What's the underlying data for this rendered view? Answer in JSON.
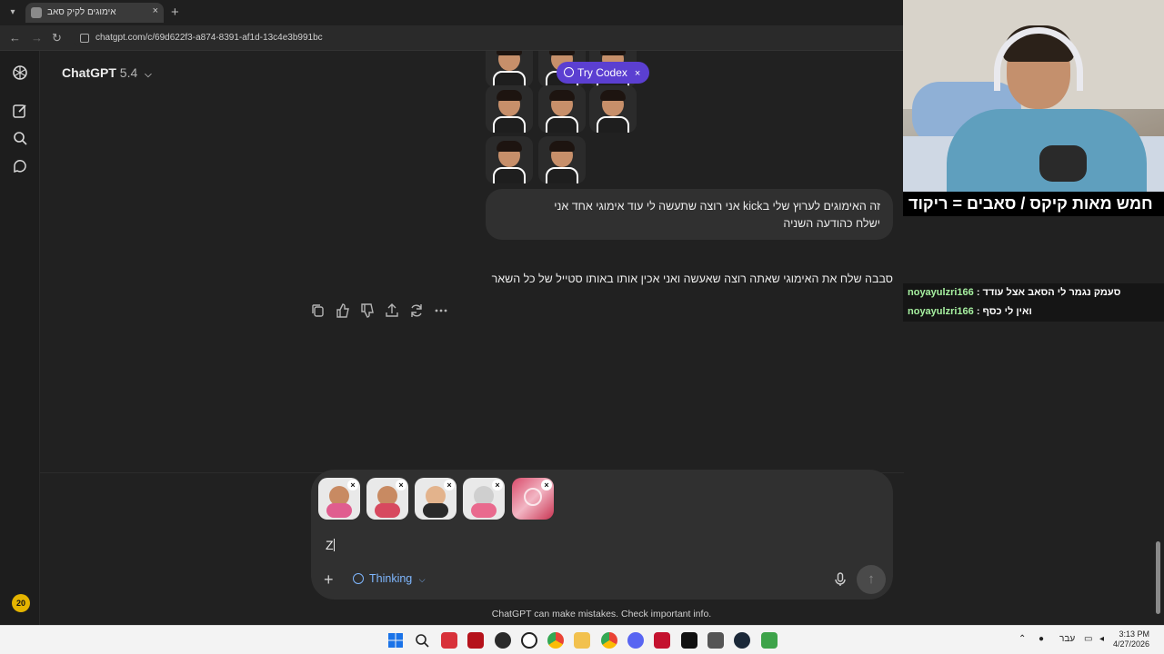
{
  "browser": {
    "tab_title": "אימוגים לקיק סאב",
    "tab_close": "×",
    "new_tab": "+",
    "url": "chatgpt.com/c/69d622f3-a874-8391-af1d-13c4e3b991bc"
  },
  "header": {
    "app_name": "ChatGPT",
    "model_version": "5.4"
  },
  "promo": {
    "label": "Try Codex",
    "close": "×"
  },
  "conversation": {
    "user_message_line1": "זה האימוגים לערוץ שלי בkick  אני רוצה שתעשה לי עוד אימוגי אחד אני",
    "user_message_line2": "ישלח כהודעה השניה",
    "assistant_reply": "סבבה שלח את האימוגי שאתה רוצה שאעשה ואני אכין אותו באותו סטייל של כל השאר"
  },
  "composer": {
    "input_value": "Z",
    "thinking_label": "Thinking",
    "plus": "+",
    "send": "↑",
    "attachment_remove": "×"
  },
  "footer": {
    "disclaimer": "ChatGPT can make mistakes. Check important info."
  },
  "sidebar": {
    "avatar_badge": "20"
  },
  "stream": {
    "caption": "חמש מאות קיקס / סאבים = ריקוד",
    "chat": [
      {
        "user": "noyayulzri166",
        "message": "סעמק נגמר לי הסאב אצל עודד"
      },
      {
        "user": "noyayulzri166",
        "message": "ואין לי כסף"
      }
    ]
  },
  "taskbar": {
    "lang": "עבר",
    "time": "3:13 PM",
    "date": "4/27/2026"
  },
  "colors": {
    "background": "#212121",
    "bubble": "#303030",
    "codex": "#5b3fd1",
    "thinking": "#7fb7ff",
    "chat_user": "#a6f0a0"
  }
}
